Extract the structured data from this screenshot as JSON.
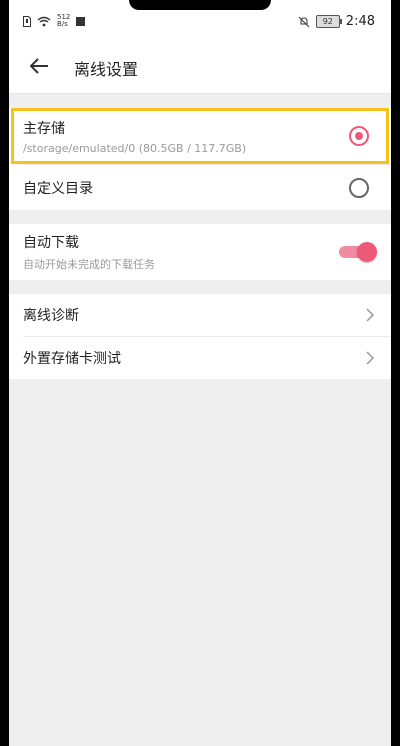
{
  "status_bar": {
    "network_speed_value": "512",
    "network_speed_unit": "B/s",
    "battery_level": "92",
    "time": "2:48"
  },
  "header": {
    "title": "离线设置"
  },
  "storage": {
    "main": {
      "label": "主存储",
      "path": "/storage/emulated/0 (80.5GB / 117.7GB)",
      "selected": true
    },
    "custom": {
      "label": "自定义目录",
      "selected": false
    }
  },
  "auto_download": {
    "label": "自动下载",
    "description": "自动开始未完成的下载任务",
    "enabled": true
  },
  "menu": {
    "diagnose_label": "离线诊断",
    "sdcard_test_label": "外置存储卡测试"
  },
  "colors": {
    "accent": "#ec5a78",
    "highlight_border": "#f8c21b"
  }
}
